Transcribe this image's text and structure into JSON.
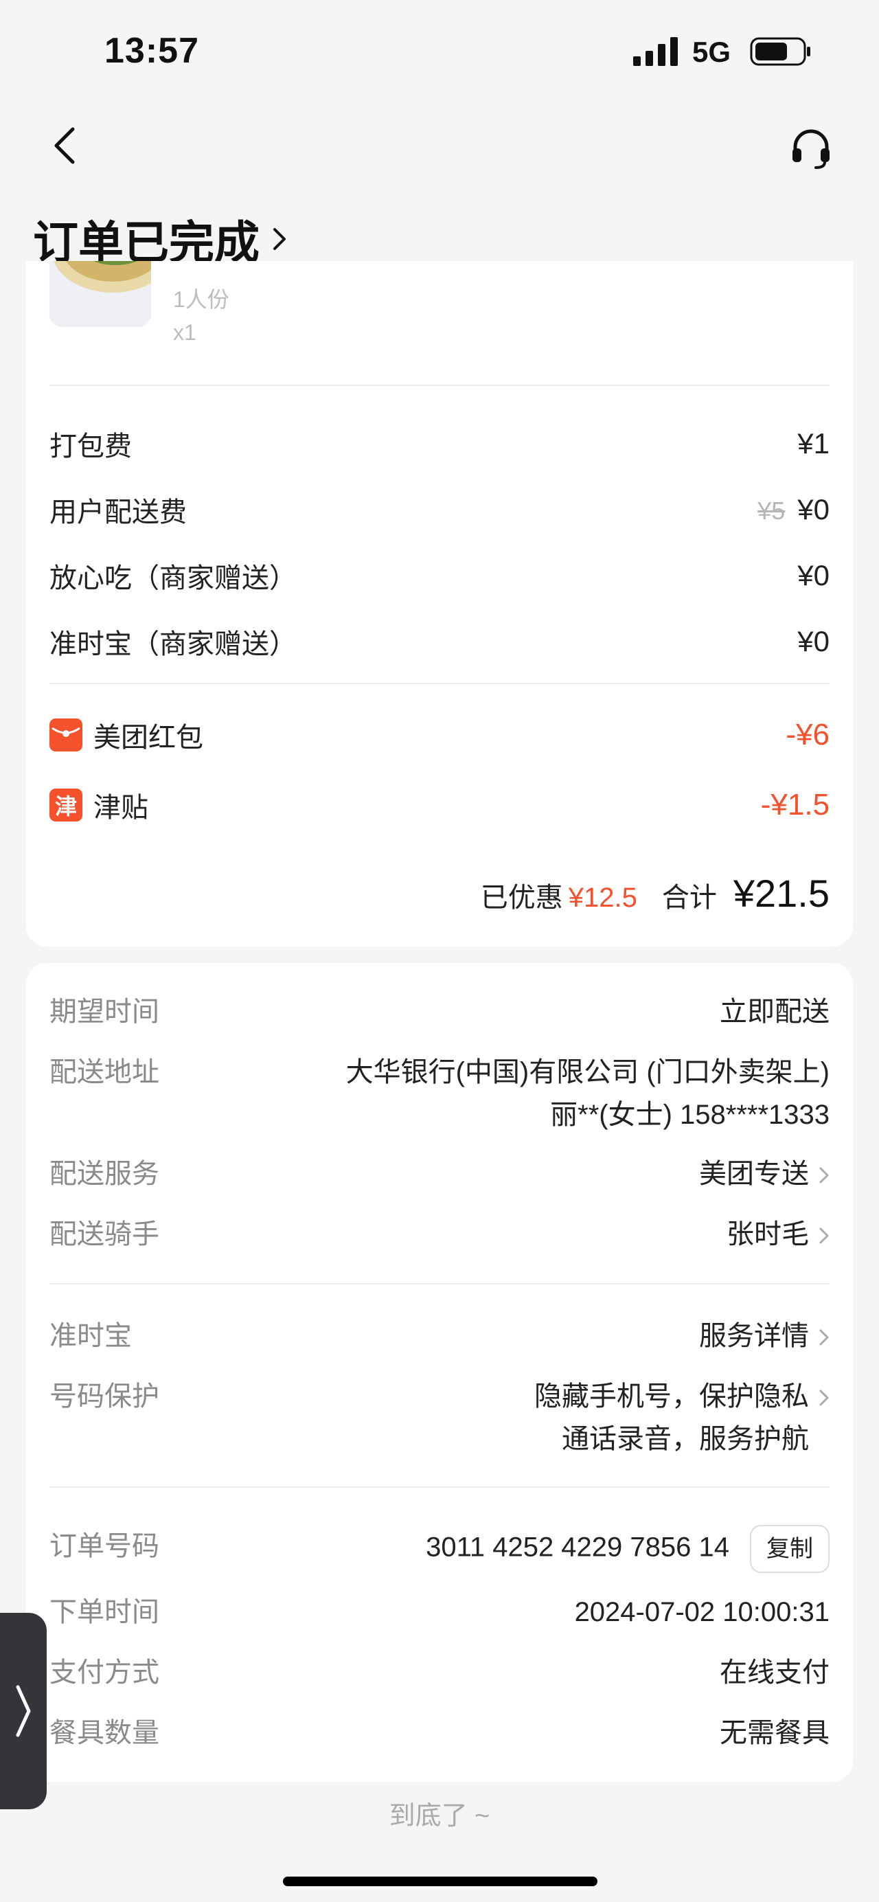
{
  "status": {
    "time": "13:57",
    "network": "5G"
  },
  "header": {
    "title": "订单已完成",
    "icons": [
      "back-icon",
      "headset-icon",
      "chevron-right-icon"
    ]
  },
  "food": {
    "spec": "1人份",
    "qty": "x1"
  },
  "fees": [
    {
      "label": "打包费",
      "amount": "¥1"
    },
    {
      "label": "用户配送费",
      "original": "¥5",
      "amount": "¥0"
    },
    {
      "label": "放心吃（商家赠送）",
      "amount": "¥0"
    },
    {
      "label": "准时宝（商家赠送）",
      "amount": "¥0"
    }
  ],
  "discounts": [
    {
      "label": "美团红包",
      "amount": "-¥6",
      "icon": "red-packet-icon"
    },
    {
      "label": "津贴",
      "icon_text": "津",
      "amount": "-¥1.5",
      "icon": "allowance-icon"
    }
  ],
  "summary": {
    "saved_label": "已优惠",
    "saved_amount": "¥12.5",
    "total_label": "合计",
    "total": "¥21.5"
  },
  "delivery": {
    "expected_time": {
      "label": "期望时间",
      "value": "立即配送"
    },
    "address": {
      "label": "配送地址",
      "line1": "大华银行(中国)有限公司 (门口外卖架上)",
      "line2": "丽**(女士) 158****1333"
    },
    "service": {
      "label": "配送服务",
      "value": "美团专送"
    },
    "rider": {
      "label": "配送骑手",
      "value": "张时毛"
    }
  },
  "protection": {
    "ontime": {
      "label": "准时宝",
      "value": "服务详情"
    },
    "number": {
      "label": "号码保护",
      "line1": "隐藏手机号，保护隐私",
      "line2": "通话录音，服务护航"
    }
  },
  "order": {
    "number": {
      "label": "订单号码",
      "value": "3011 4252 4229 7856 14",
      "copy": "复制"
    },
    "time": {
      "label": "下单时间",
      "value": "2024-07-02 10:00:31"
    },
    "payment": {
      "label": "支付方式",
      "value": "在线支付"
    },
    "utensils": {
      "label": "餐具数量",
      "value": "无需餐具"
    }
  },
  "footer": {
    "end_note": "到底了 ~"
  },
  "colors": {
    "accent": "#f4512c",
    "background": "#f5f5f5",
    "card": "#ffffff"
  }
}
